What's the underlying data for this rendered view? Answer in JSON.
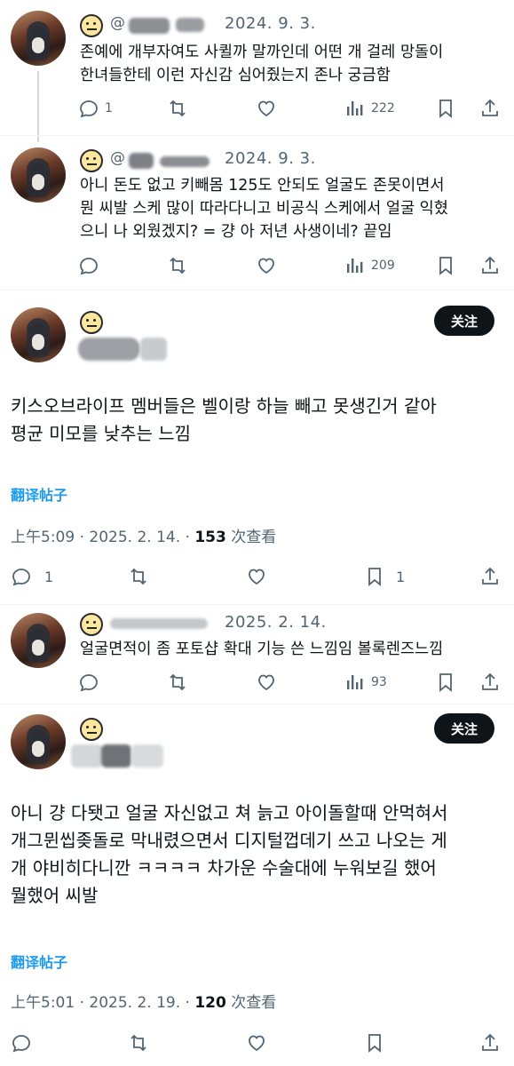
{
  "replies": [
    {
      "handle": "@",
      "date": "2024. 9. 3.",
      "text_lines": [
        "존예에 개부자여도 사퀼까 말까인데 어떤 개 걸레 망돌이",
        "한녀들한테 이런 자신감 심어줬는지 존나 궁금함"
      ],
      "replies": "1",
      "views": "222"
    },
    {
      "handle": "@",
      "date": "2024. 9. 3.",
      "text_lines": [
        "아니 돈도 없고 키빼몸 125도 안되도 얼굴도 존못이면서",
        "뭔 씨발 스케 많이 따라다니고 비공식 스케에서 얼굴 익혔",
        "으니 나 외웠겠지? = 걍 아 저년 사생이네? 끝임"
      ],
      "replies": "",
      "views": "209"
    }
  ],
  "main_post": {
    "follow_label": "关注",
    "text_lines": [
      "키스오브라이프 멤버들은 벨이랑 하늘 빼고 못생긴거 같아",
      "평균 미모를 낮추는 느낌"
    ],
    "translate_label": "翻译帖子",
    "time": "上午5:09 · 2025. 2. 14. · ",
    "views": "153",
    "views_suffix": " 次查看",
    "replies": "1",
    "bookmarks": "1"
  },
  "reply3": {
    "date": "2025. 2. 14.",
    "text": "얼굴면적이 좀 포토샵 확대 기능 쓴 느낌임 볼록렌즈느낌",
    "views": "93"
  },
  "second_post": {
    "follow_label": "关注",
    "text_lines": [
      "아니 걍 다됏고 얼굴 자신없고 쳐 늙고 아이돌할때 안먹혀서",
      "개그뮌씹좆돌로 막내렸으면서 디지털껍데기 쓰고 나오는 게",
      "개 야비히다니깐 ㅋㅋㅋㅋ 차가운 수술대에 누워보길 했어",
      "뭘했어 씨발"
    ],
    "translate_label": "翻译帖子",
    "time": "上午5:01 · 2025. 2. 19. · ",
    "views": "120",
    "views_suffix": " 次查看"
  },
  "icons": [
    "reply-icon",
    "retweet-icon",
    "like-icon",
    "views-icon",
    "bookmark-icon",
    "share-icon"
  ]
}
